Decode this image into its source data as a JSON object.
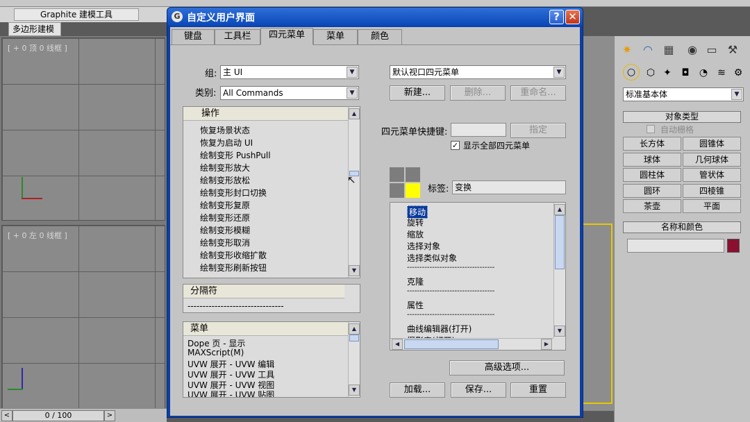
{
  "app": {
    "ribbon": {
      "graphite_tab": "Graphite 建模工具",
      "poly_tab": "多边形建模"
    },
    "viewports": {
      "top_label": "[ + 0 顶 0 线框 ]",
      "left_label": "[ + 0 左 0 线框 ]"
    },
    "timeline": {
      "frame": "0 / 100",
      "prev": "<",
      "next": ">"
    },
    "command_panel": {
      "category_select": "标准基本体",
      "object_type_header": "对象类型",
      "auto_grid_label": "自动栅格",
      "buttons": [
        "长方体",
        "圆锥体",
        "球体",
        "几何球体",
        "圆柱体",
        "管状体",
        "圆环",
        "四棱锥",
        "茶壶",
        "平面"
      ],
      "name_color_header": "名称和颜色",
      "color_swatch": "#8b1030"
    }
  },
  "dialog": {
    "title": "自定义用户界面",
    "help_label": "?",
    "close_label": "✕",
    "tabs": [
      "键盘",
      "工具栏",
      "四元菜单",
      "菜单",
      "颜色"
    ],
    "active_tab": "四元菜单",
    "group_label": "组:",
    "group_value": "主 UI",
    "category_label": "类别:",
    "category_value": "All Commands",
    "actions": {
      "header": "操作",
      "items": [
        "恢复场景状态",
        "恢复为启动 UI",
        "绘制变形 PushPull",
        "绘制变形放大",
        "绘制变形放松",
        "绘制变形封口切换",
        "绘制变形复原",
        "绘制变形还原",
        "绘制变形模糊",
        "绘制变形取消",
        "绘制变形收缩扩散",
        "绘制变形刷新按钮"
      ]
    },
    "separator": {
      "header": "分隔符",
      "line": "--------------------------------"
    },
    "menus": {
      "header": "菜单",
      "items": [
        "Dope 页 - 显示",
        "MAXScript(M)",
        "UVW 展开 - UVW 编辑",
        "UVW 展开 - UVW 工具",
        "UVW 展开 - UVW 视图",
        "UVW 展开 - UVW 贴图"
      ]
    },
    "quad_menu_select": "默认视口四元菜单",
    "new_button": "新建...",
    "delete_button": "删除...",
    "rename_button": "重命名...",
    "shortcut_label": "四元菜单快捷键:",
    "assign_button": "指定",
    "show_all_label": "显示全部四元菜单",
    "show_all_checked": true,
    "tag_label": "标签:",
    "tag_value": "变换",
    "quad_colors": {
      "normal": "#7d7d7d",
      "active": "#ffff00"
    },
    "quad_items": [
      "移动",
      "旋转",
      "缩放",
      "选择对象",
      "选择类似对象",
      "-----------------------------------",
      "克隆",
      "-----------------------------------",
      "属性",
      "-----------------------------------",
      "曲线编辑器(打开)",
      "摄影表(打开)"
    ],
    "advanced_button": "高级选项...",
    "load_button": "加载...",
    "save_button": "保存...",
    "reset_button": "重置"
  }
}
